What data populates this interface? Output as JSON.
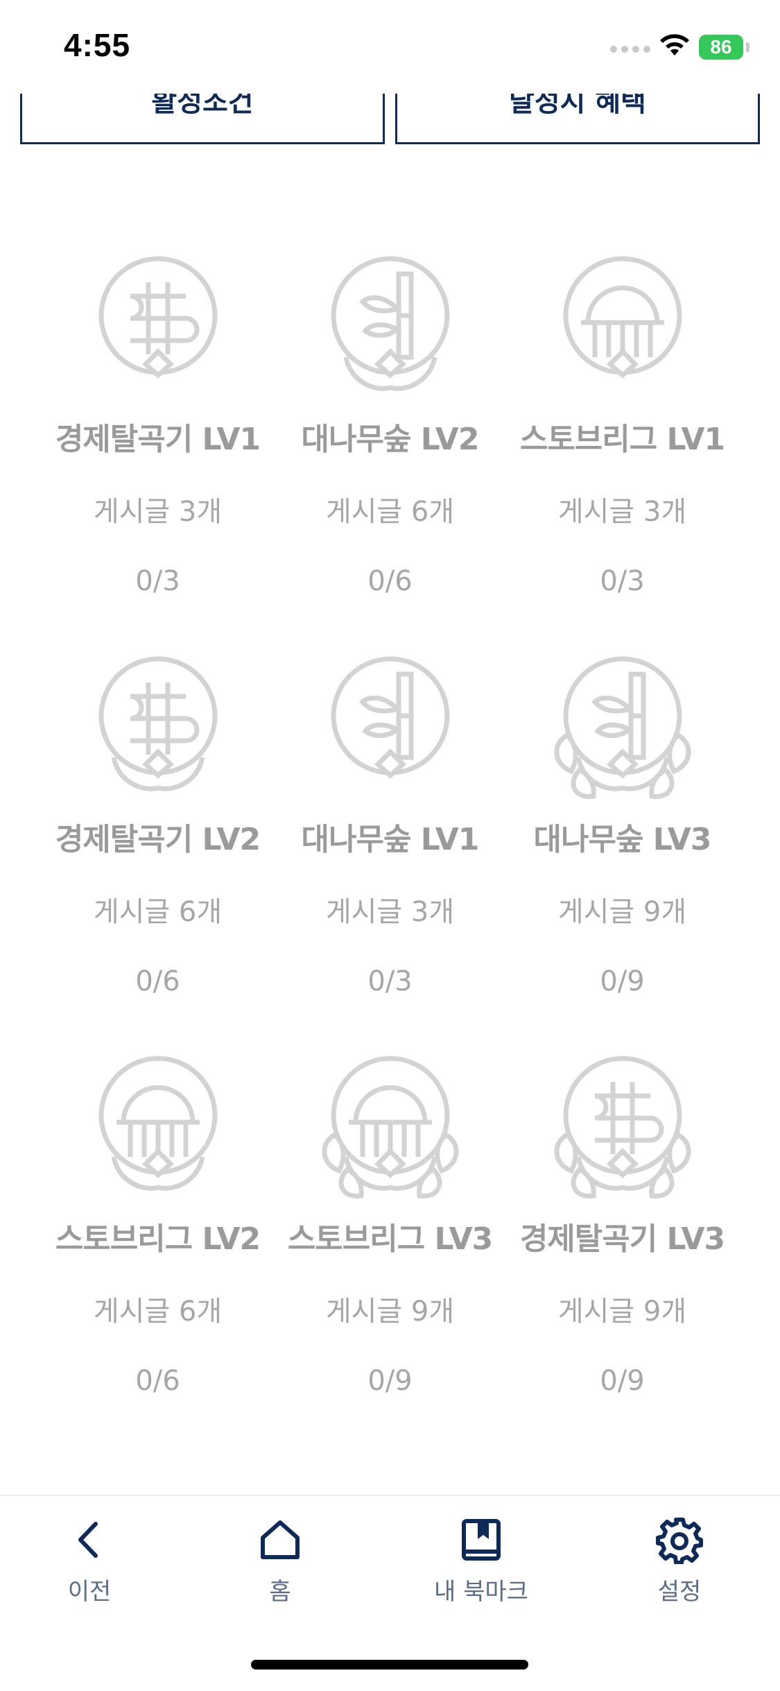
{
  "status_bar": {
    "time": "4:55",
    "battery": "86"
  },
  "top_buttons": {
    "left_label": "활성조건",
    "right_label": "달성시 혜택"
  },
  "badges": [
    {
      "name": "경제탈곡기 LV1",
      "requirement": "게시글 3개",
      "progress": "0/3",
      "icon": "dollar-icon",
      "level": 1
    },
    {
      "name": "대나무숲 LV2",
      "requirement": "게시글 6개",
      "progress": "0/6",
      "icon": "bamboo-icon",
      "level": 2
    },
    {
      "name": "스토브리그 LV1",
      "requirement": "게시글 3개",
      "progress": "0/3",
      "icon": "stadium-icon",
      "level": 1
    },
    {
      "name": "경제탈곡기 LV2",
      "requirement": "게시글 6개",
      "progress": "0/6",
      "icon": "dollar-icon",
      "level": 2
    },
    {
      "name": "대나무숲 LV1",
      "requirement": "게시글 3개",
      "progress": "0/3",
      "icon": "bamboo-icon",
      "level": 1
    },
    {
      "name": "대나무숲 LV3",
      "requirement": "게시글 9개",
      "progress": "0/9",
      "icon": "bamboo-icon",
      "level": 3
    },
    {
      "name": "스토브리그 LV2",
      "requirement": "게시글 6개",
      "progress": "0/6",
      "icon": "stadium-icon",
      "level": 2
    },
    {
      "name": "스토브리그 LV3",
      "requirement": "게시글 9개",
      "progress": "0/9",
      "icon": "stadium-icon",
      "level": 3
    },
    {
      "name": "경제탈곡기 LV3",
      "requirement": "게시글 9개",
      "progress": "0/9",
      "icon": "dollar-icon",
      "level": 3
    }
  ],
  "bottom_nav": {
    "back": "이전",
    "home": "홈",
    "bookmark": "내 북마크",
    "settings": "설정"
  },
  "colors": {
    "navy": "#0e2a5a",
    "badge_gray": "#d3d3d3",
    "text_gray": "#a6a6a6",
    "battery_green": "#34c759"
  }
}
